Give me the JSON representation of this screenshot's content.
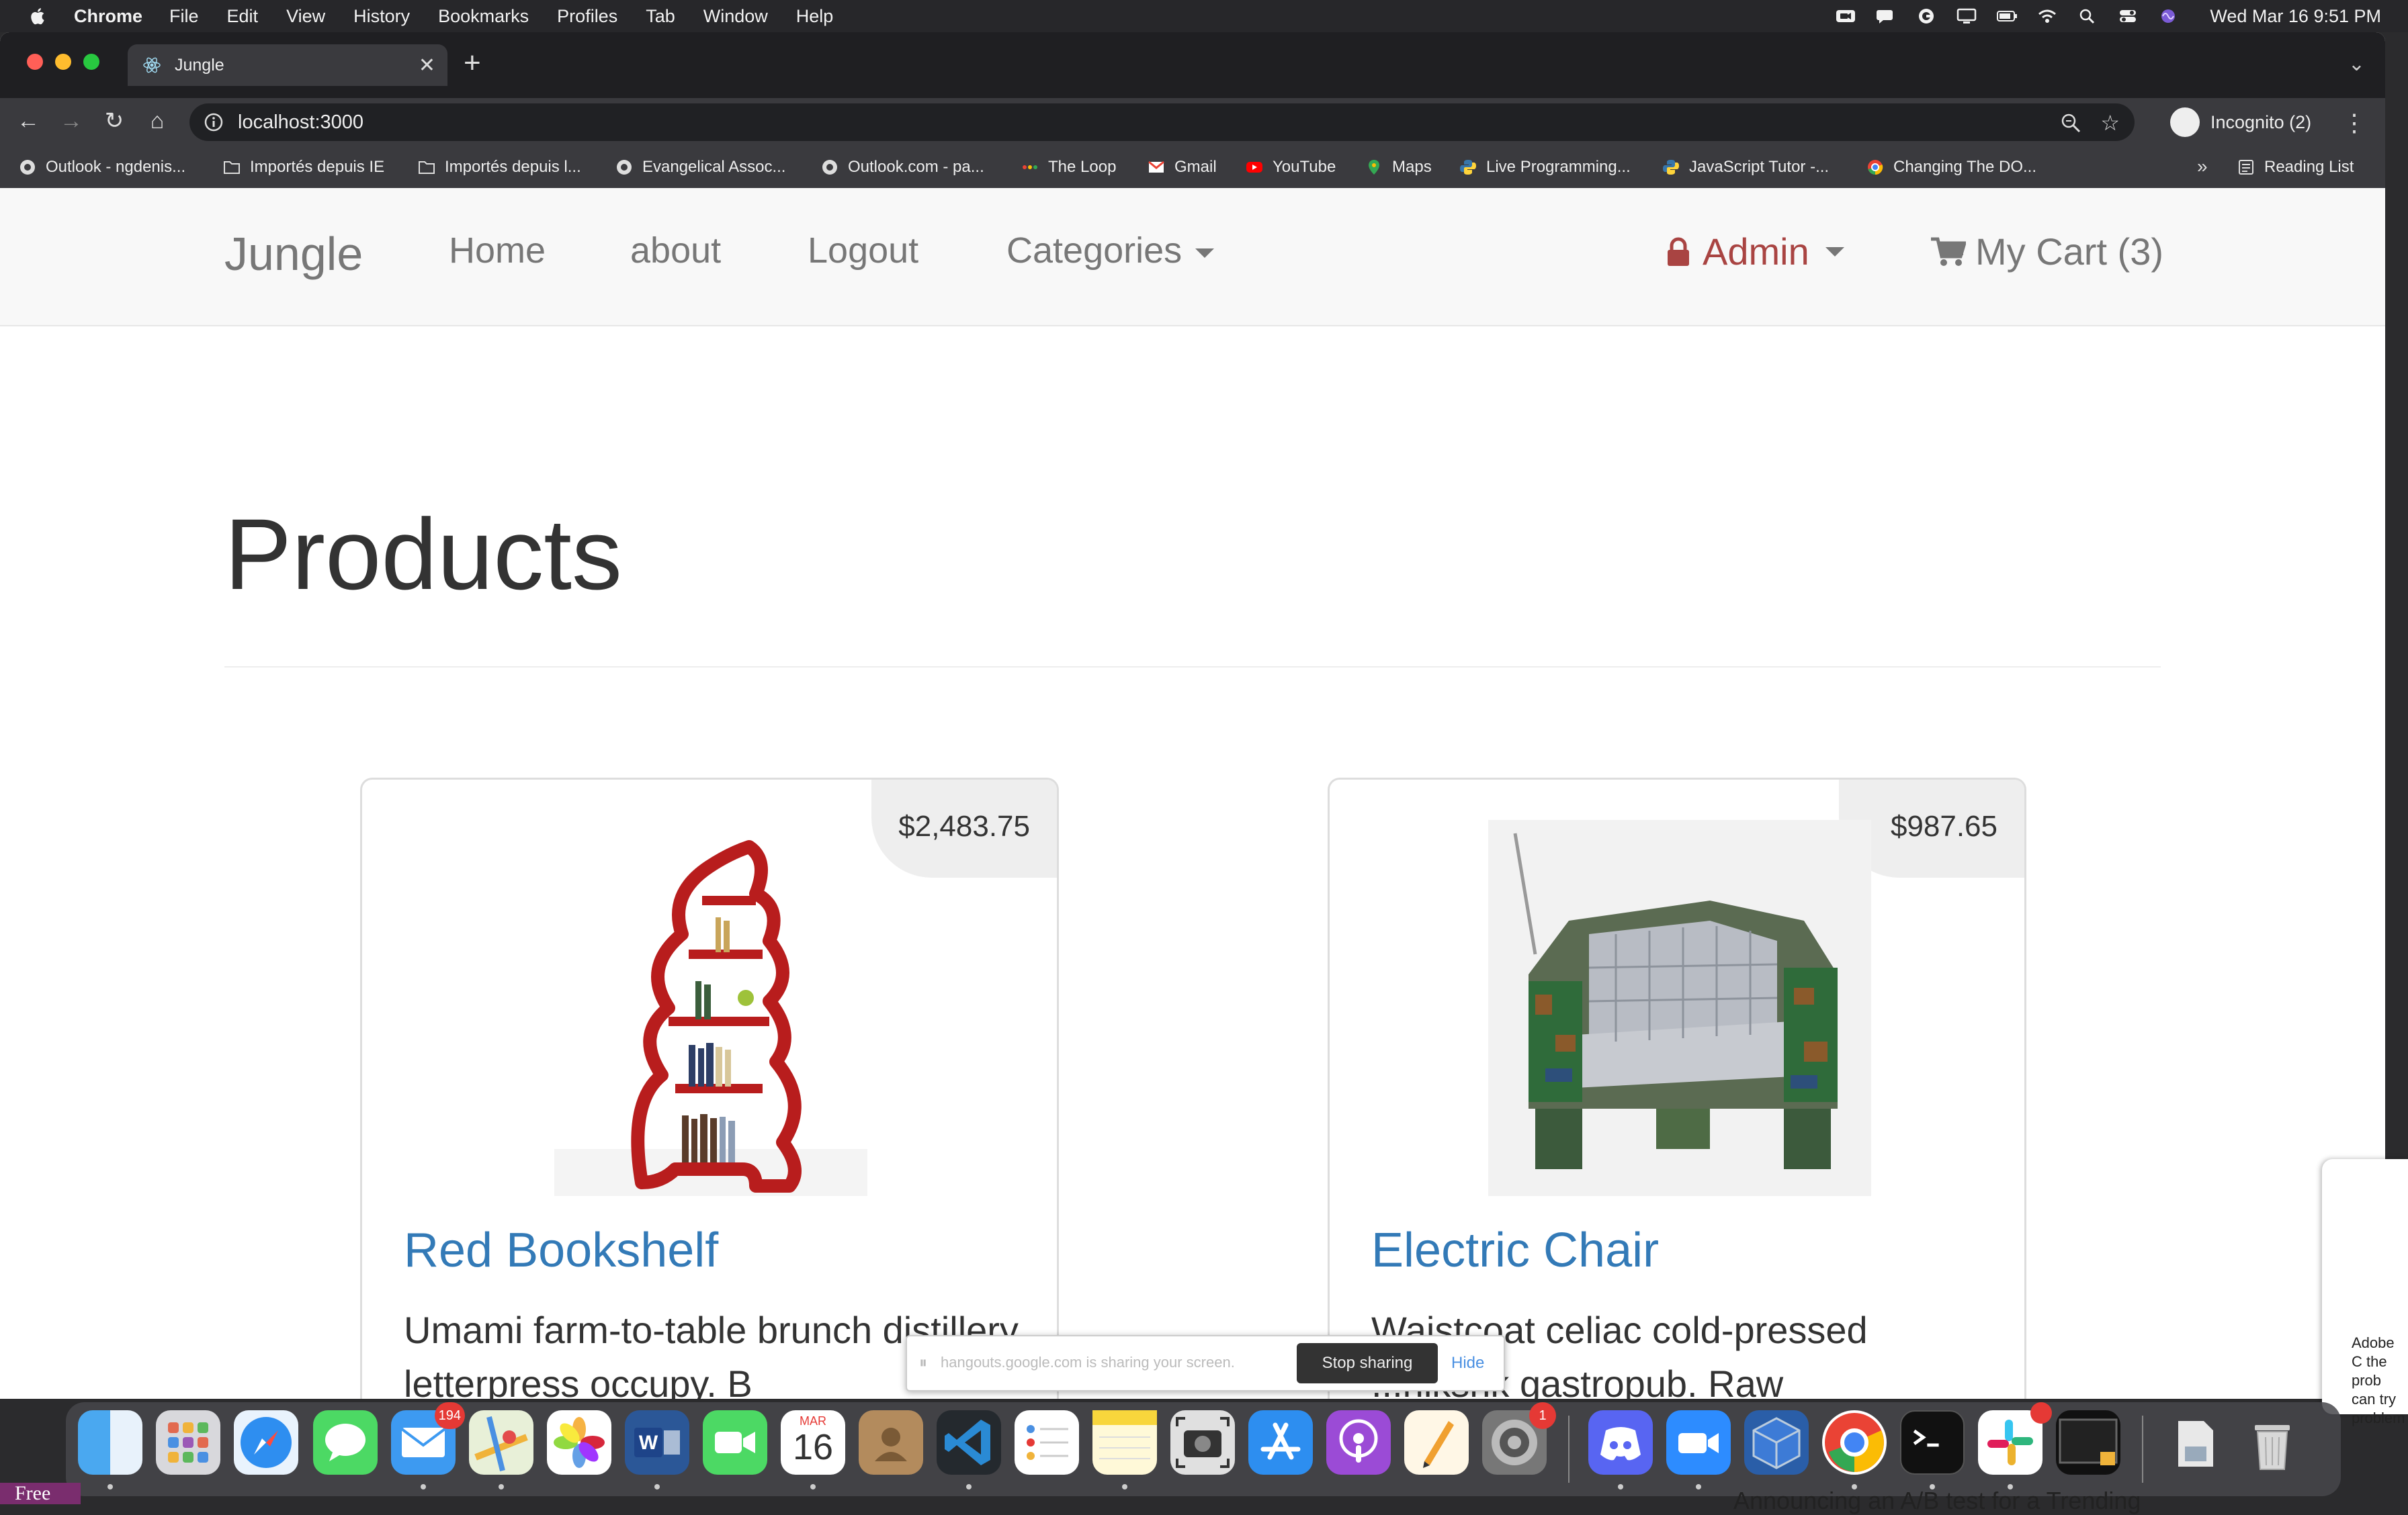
{
  "menubar": {
    "app_name": "Chrome",
    "menus": [
      "File",
      "Edit",
      "View",
      "History",
      "Bookmarks",
      "Profiles",
      "Tab",
      "Window",
      "Help"
    ],
    "clock": "Wed Mar 16  9:51 PM"
  },
  "browser": {
    "tab_title": "Jungle",
    "url": "localhost:3000",
    "profile_label": "Incognito (2)",
    "bookmarks": [
      "Outlook - ngdenis...",
      "Importés depuis IE",
      "Importés depuis l...",
      "Evangelical Assoc...",
      "Outlook.com - pa...",
      "The Loop",
      "Gmail",
      "YouTube",
      "Maps",
      "Live Programming...",
      "JavaScript Tutor -...",
      "Changing The DO..."
    ],
    "bookmarks_more": "»",
    "reading_list": "Reading List"
  },
  "site": {
    "brand": "Jungle",
    "nav": {
      "home": "Home",
      "about": "about",
      "logout": "Logout",
      "categories": "Categories",
      "admin": "Admin",
      "cart": "My Cart (3)"
    },
    "page_title": "Products",
    "products": [
      {
        "name": "Red Bookshelf",
        "price": "$2,483.75",
        "description": "Umami farm-to-table brunch distillery letterpress occupy. B"
      },
      {
        "name": "Electric Chair",
        "price": "$987.65",
        "description": "Waistcoat celiac cold-pressed ...nlkshk gastropub. Raw"
      }
    ]
  },
  "share_bar": {
    "text": "hangouts.google.com is sharing your screen.",
    "stop_label": "Stop sharing",
    "hide_label": "Hide"
  },
  "adobe_panel": {
    "text": "Adobe C the prob can try problem"
  },
  "dock": {
    "mail_badge": "194",
    "calendar_month": "MAR",
    "calendar_day": "16",
    "settings_badge": "1"
  },
  "overlays": {
    "free_tag": "Free",
    "bottom_text": "Announcing an A/B test for a Trending"
  },
  "colors": {
    "link_blue": "#337ab7",
    "admin_red": "#a94442",
    "navbar_bg": "#f8f8f8"
  }
}
